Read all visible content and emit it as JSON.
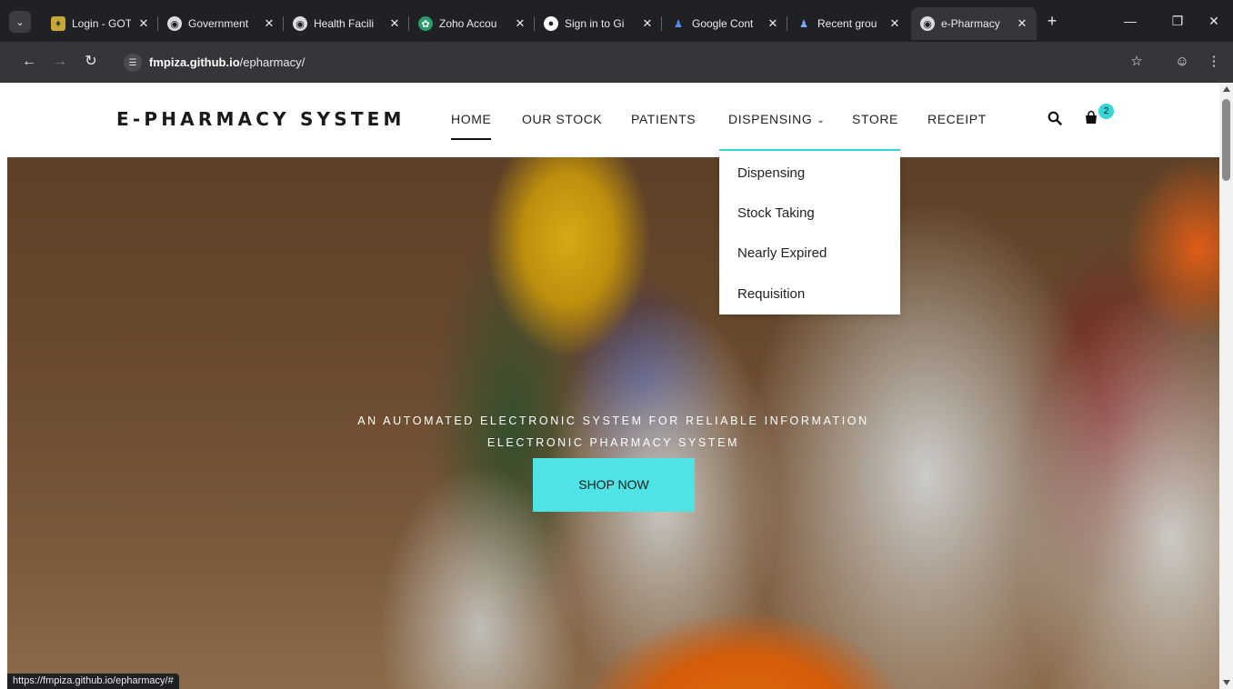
{
  "browser": {
    "tabs": [
      {
        "label": "Login - GOTH",
        "favicon": "crest-icon",
        "active": false
      },
      {
        "label": "Government",
        "favicon": "globe-icon",
        "active": false
      },
      {
        "label": "Health Facili",
        "favicon": "globe-icon",
        "active": false
      },
      {
        "label": "Zoho Accou",
        "favicon": "zoho-icon",
        "active": false
      },
      {
        "label": "Sign in to Gi",
        "favicon": "github-icon",
        "active": false
      },
      {
        "label": "Google Cont",
        "favicon": "contacts-icon",
        "active": false
      },
      {
        "label": "Recent grou",
        "favicon": "people-icon",
        "active": false
      },
      {
        "label": "e-Pharmacy",
        "favicon": "globe-icon",
        "active": true
      }
    ],
    "url_host": "fmpiza.github.io",
    "url_path": "/epharmacy/",
    "status_url": "https://fmpiza.github.io/epharmacy/#"
  },
  "site": {
    "logo": "E-PHARMACY SYSTEM",
    "nav": [
      {
        "label": "HOME",
        "active": true
      },
      {
        "label": "OUR STOCK"
      },
      {
        "label": "PATIENTS"
      },
      {
        "label": "DISPENSING"
      },
      {
        "label": "STORE"
      },
      {
        "label": "RECEIPT"
      }
    ],
    "cart_count": "2",
    "dropdown": [
      "Dispensing",
      "Stock Taking",
      "Nearly Expired",
      "Requisition"
    ],
    "hero": {
      "tagline": "AN AUTOMATED ELECTRONIC SYSTEM FOR RELIABLE INFORMATION",
      "subtitle": "ELECTRONIC PHARMACY SYSTEM",
      "button": "SHOP NOW"
    },
    "accent_color": "#37d5d6"
  }
}
